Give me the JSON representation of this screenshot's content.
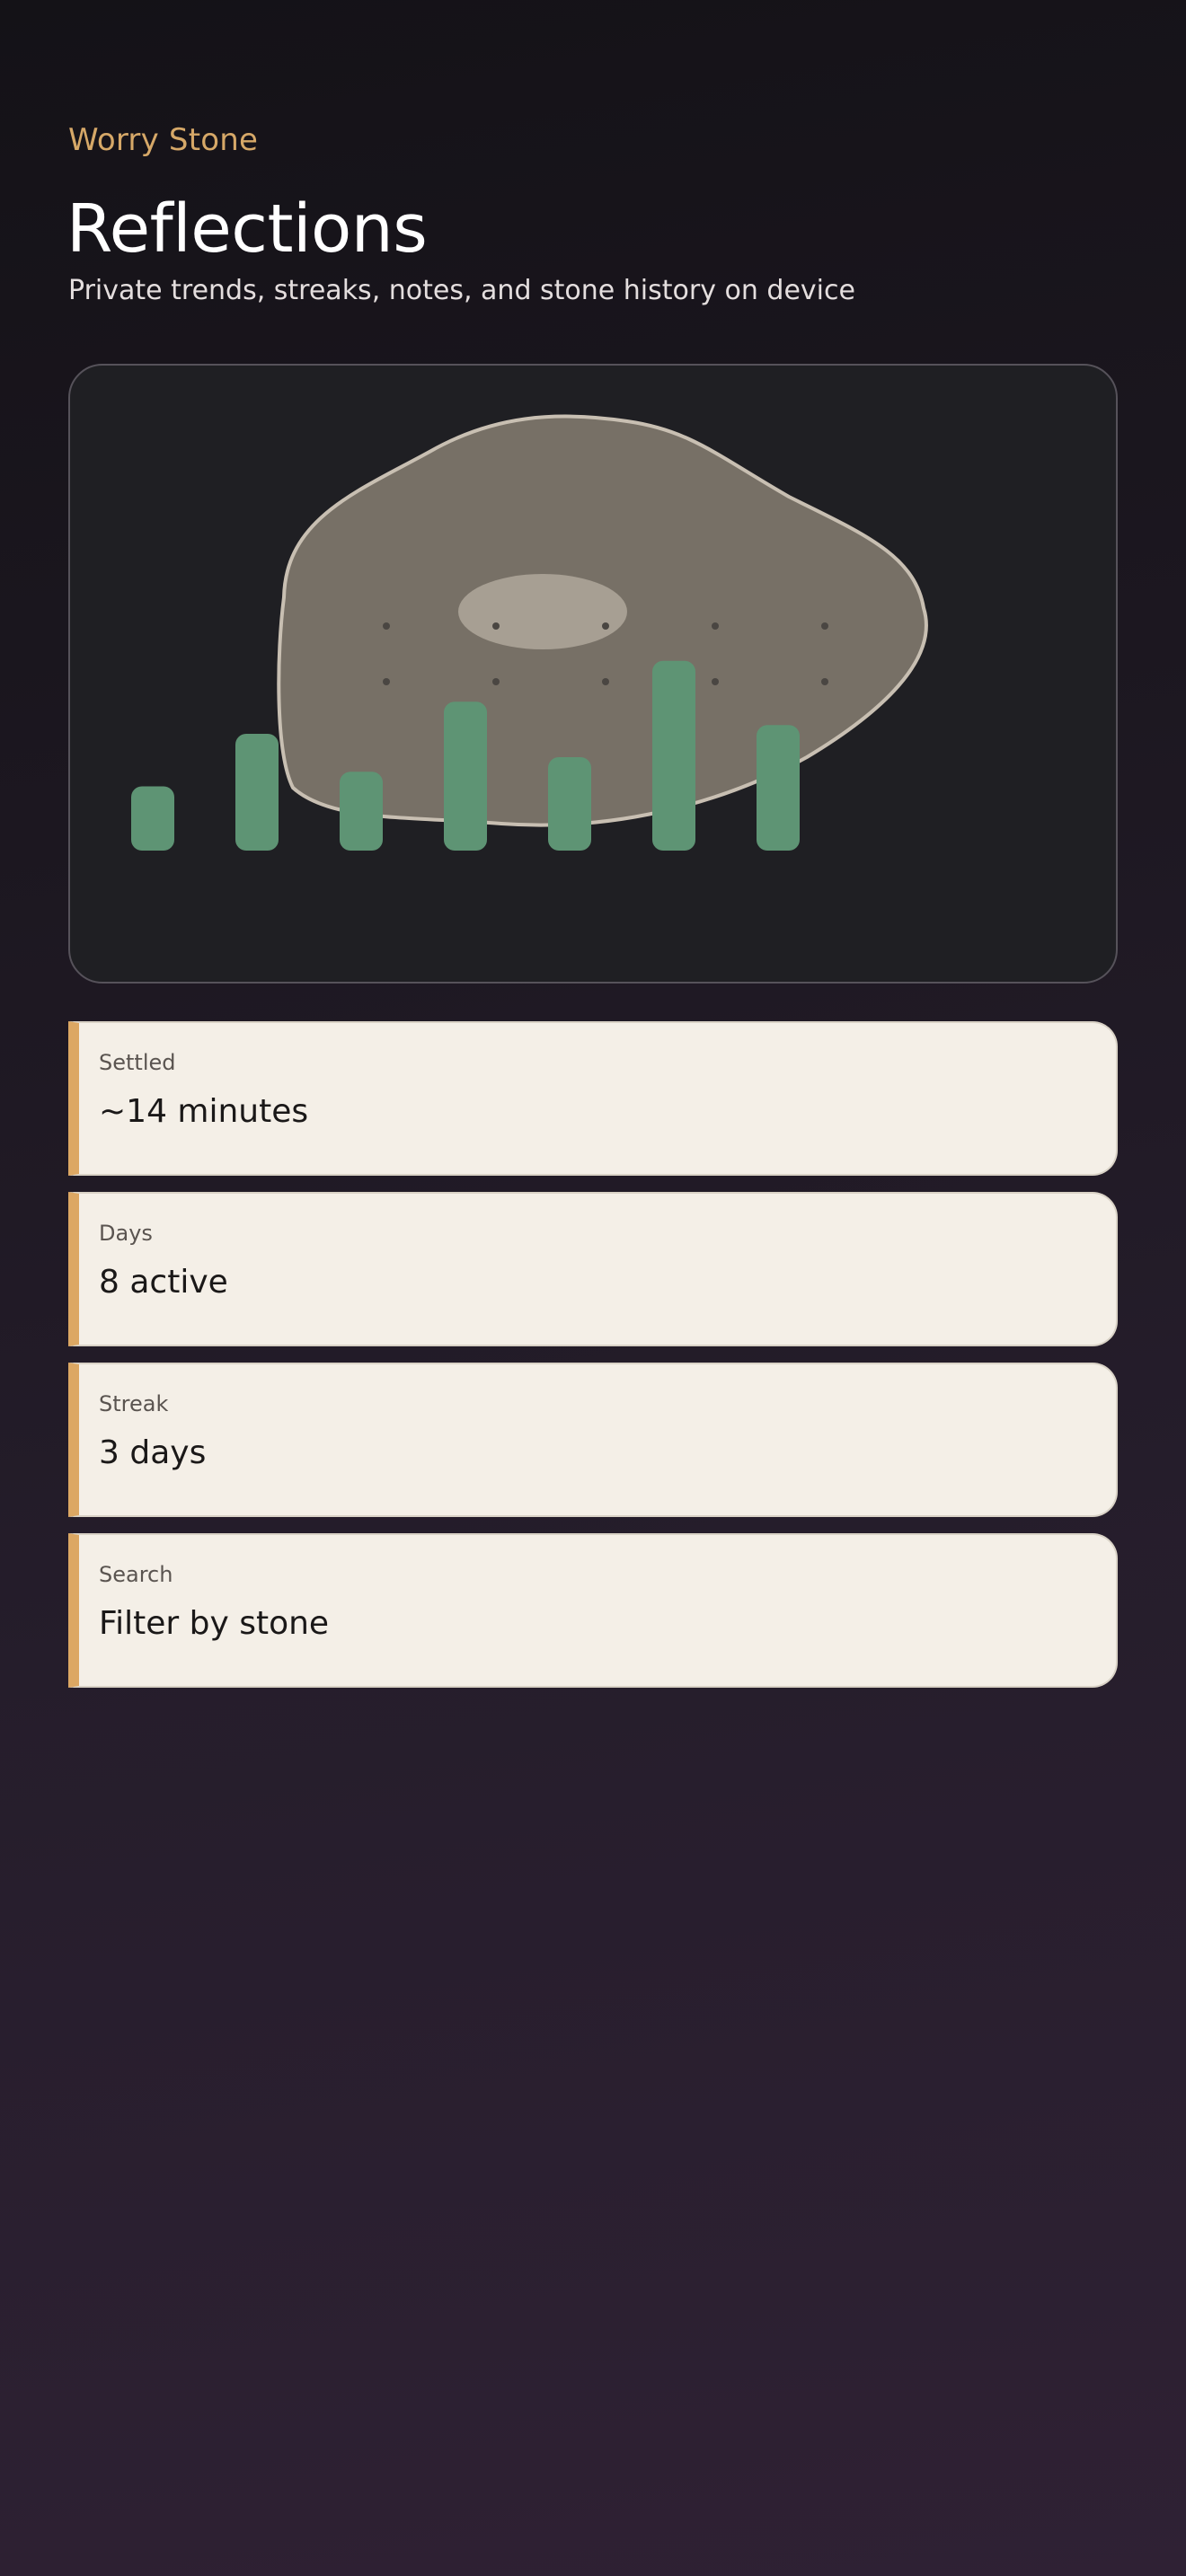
{
  "app": {
    "name": "Worry Stone"
  },
  "header": {
    "title": "Reflections",
    "subtitle": "Private trends, streaks, notes, and stone history on device"
  },
  "colors": {
    "accent": "#dca763",
    "bar": "#5e9474",
    "stone": "#777066",
    "stone_highlight": "#a79f93",
    "card_bg": "#f4efe7"
  },
  "visual": {
    "icons": [
      "worry-stone-illustration"
    ],
    "chart_data": {
      "type": "bar",
      "categories": [],
      "values": [
        0.22,
        0.4,
        0.27,
        0.51,
        0.32,
        0.65,
        0.43
      ],
      "title": "",
      "xlabel": "",
      "ylabel": "",
      "grid": false,
      "note_relative_heights_only": true
    }
  },
  "stats": [
    {
      "label": "Settled",
      "value": "~14 minutes"
    },
    {
      "label": "Days",
      "value": "8 active"
    },
    {
      "label": "Streak",
      "value": "3 days"
    },
    {
      "label": "Search",
      "value": "Filter by stone"
    }
  ]
}
